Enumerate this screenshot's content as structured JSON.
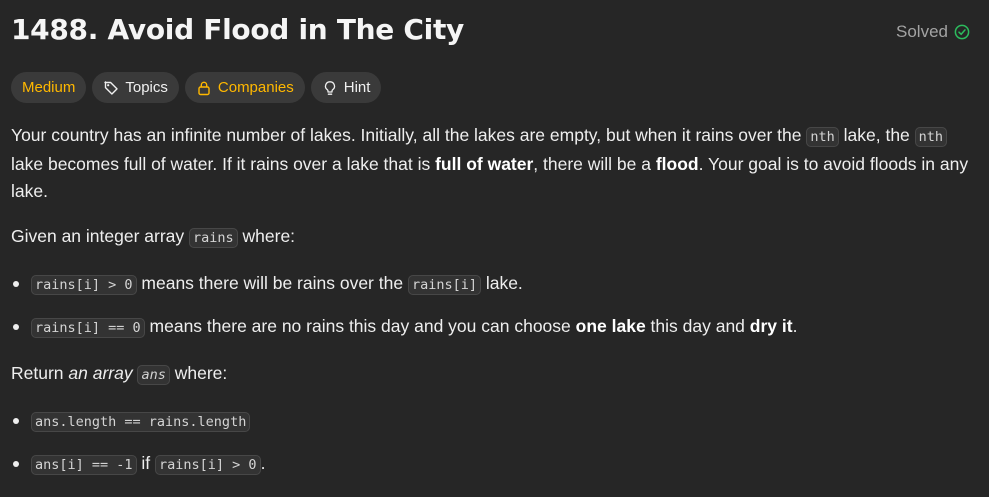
{
  "problem": {
    "title": "1488. Avoid Flood in The City",
    "status_label": "Solved"
  },
  "tags": {
    "difficulty": "Medium",
    "topics": "Topics",
    "companies": "Companies",
    "hint": "Hint"
  },
  "colors": {
    "background": "#262626",
    "medium": "#ffb800",
    "solved_check": "#2cbb5d"
  },
  "icons": {
    "solved": "check-circle-icon",
    "topics": "tag-icon",
    "companies": "lock-icon",
    "hint": "lightbulb-icon"
  },
  "description": {
    "p1": {
      "t1": "Your country has an infinite number of lakes. Initially, all the lakes are empty, but when it rains over the ",
      "c1": "nth",
      "t2": " lake, the ",
      "c2": "nth",
      "t3": " lake becomes full of water. If it rains over a lake that is ",
      "b1": "full of water",
      "t4": ", there will be a ",
      "b2": "flood",
      "t5": ". Your goal is to avoid floods in any lake."
    },
    "p2": {
      "t1": "Given an integer array ",
      "c1": "rains",
      "t2": " where:"
    },
    "list1": [
      {
        "c1": "rains[i] > 0",
        "t1": " means there will be rains over the ",
        "c2": "rains[i]",
        "t2": " lake."
      },
      {
        "c1": "rains[i] == 0",
        "t1": " means there are no rains this day and you can choose ",
        "b1": "one lake",
        "t2": " this day and ",
        "b2": "dry it",
        "t3": "."
      }
    ],
    "p3": {
      "t1": "Return ",
      "i1": "an array",
      "c1": "ans",
      "t2": " where:"
    },
    "list2": [
      {
        "c1": "ans.length == rains.length"
      },
      {
        "c1": "ans[i] == -1",
        "t1": " if ",
        "c2": "rains[i] > 0",
        "t2": "."
      }
    ]
  }
}
